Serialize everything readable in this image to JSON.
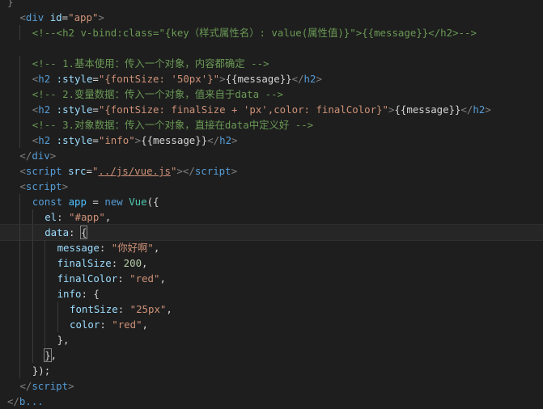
{
  "editor": {
    "lines": [
      {
        "indent": 0,
        "tokens": [
          {
            "t": "}",
            "c": "t-punct"
          }
        ]
      },
      {
        "indent": 1,
        "tokens": [
          {
            "t": "<",
            "c": "t-punct"
          },
          {
            "t": "div",
            "c": "t-tag"
          },
          {
            "t": " ",
            "c": "t-text"
          },
          {
            "t": "id",
            "c": "t-attr"
          },
          {
            "t": "=",
            "c": "t-text"
          },
          {
            "t": "\"app\"",
            "c": "t-str"
          },
          {
            "t": ">",
            "c": "t-punct"
          }
        ]
      },
      {
        "indent": 2,
        "tokens": [
          {
            "t": "<!--<h2 v-bind:class=\"{key（样式属性名）: value(属性值)}\">{{message}}</h2>-->",
            "c": "t-comment"
          }
        ]
      },
      {
        "indent": 0,
        "tokens": []
      },
      {
        "indent": 2,
        "tokens": [
          {
            "t": "<!-- 1.基本使用：传入一个对象，内容都确定 -->",
            "c": "t-comment"
          }
        ]
      },
      {
        "indent": 2,
        "tokens": [
          {
            "t": "<",
            "c": "t-punct"
          },
          {
            "t": "h2",
            "c": "t-tag"
          },
          {
            "t": " ",
            "c": "t-text"
          },
          {
            "t": ":style",
            "c": "t-attr"
          },
          {
            "t": "=",
            "c": "t-text"
          },
          {
            "t": "\"{fontSize: '50px'}\"",
            "c": "t-str"
          },
          {
            "t": ">",
            "c": "t-punct"
          },
          {
            "t": "{{message}}",
            "c": "t-text"
          },
          {
            "t": "</",
            "c": "t-punct"
          },
          {
            "t": "h2",
            "c": "t-tag"
          },
          {
            "t": ">",
            "c": "t-punct"
          }
        ]
      },
      {
        "indent": 2,
        "tokens": [
          {
            "t": "<!-- 2.变量数据：传入一个对象，值来自于data -->",
            "c": "t-comment"
          }
        ]
      },
      {
        "indent": 2,
        "tokens": [
          {
            "t": "<",
            "c": "t-punct"
          },
          {
            "t": "h2",
            "c": "t-tag"
          },
          {
            "t": " ",
            "c": "t-text"
          },
          {
            "t": ":style",
            "c": "t-attr"
          },
          {
            "t": "=",
            "c": "t-text"
          },
          {
            "t": "\"{fontSize: finalSize + 'px',color: finalColor}\"",
            "c": "t-str"
          },
          {
            "t": ">",
            "c": "t-punct"
          },
          {
            "t": "{{message}}",
            "c": "t-text"
          },
          {
            "t": "</",
            "c": "t-punct"
          },
          {
            "t": "h2",
            "c": "t-tag"
          },
          {
            "t": ">",
            "c": "t-punct"
          }
        ]
      },
      {
        "indent": 2,
        "tokens": [
          {
            "t": "<!-- 3.对象数据：传入一个对象，直接在data中定义好 -->",
            "c": "t-comment"
          }
        ]
      },
      {
        "indent": 2,
        "tokens": [
          {
            "t": "<",
            "c": "t-punct"
          },
          {
            "t": "h2",
            "c": "t-tag"
          },
          {
            "t": " ",
            "c": "t-text"
          },
          {
            "t": ":style",
            "c": "t-attr"
          },
          {
            "t": "=",
            "c": "t-text"
          },
          {
            "t": "\"info\"",
            "c": "t-str"
          },
          {
            "t": ">",
            "c": "t-punct"
          },
          {
            "t": "{{message}}",
            "c": "t-text"
          },
          {
            "t": "</",
            "c": "t-punct"
          },
          {
            "t": "h2",
            "c": "t-tag"
          },
          {
            "t": ">",
            "c": "t-punct"
          }
        ]
      },
      {
        "indent": 1,
        "tokens": [
          {
            "t": "</",
            "c": "t-punct"
          },
          {
            "t": "div",
            "c": "t-tag"
          },
          {
            "t": ">",
            "c": "t-punct"
          }
        ]
      },
      {
        "indent": 1,
        "tokens": [
          {
            "t": "<",
            "c": "t-punct"
          },
          {
            "t": "script",
            "c": "t-tag"
          },
          {
            "t": " ",
            "c": "t-text"
          },
          {
            "t": "src",
            "c": "t-attr"
          },
          {
            "t": "=",
            "c": "t-text"
          },
          {
            "t": "\"",
            "c": "t-str"
          },
          {
            "t": "../js/vue.js",
            "c": "t-link"
          },
          {
            "t": "\"",
            "c": "t-str"
          },
          {
            "t": "></",
            "c": "t-punct"
          },
          {
            "t": "script",
            "c": "t-tag"
          },
          {
            "t": ">",
            "c": "t-punct"
          }
        ]
      },
      {
        "indent": 1,
        "tokens": [
          {
            "t": "<",
            "c": "t-punct"
          },
          {
            "t": "script",
            "c": "t-tag"
          },
          {
            "t": ">",
            "c": "t-punct"
          }
        ]
      },
      {
        "indent": 2,
        "tokens": [
          {
            "t": "const",
            "c": "t-kw"
          },
          {
            "t": " ",
            "c": "t-text"
          },
          {
            "t": "app",
            "c": "t-var"
          },
          {
            "t": " = ",
            "c": "t-text"
          },
          {
            "t": "new",
            "c": "t-kw"
          },
          {
            "t": " ",
            "c": "t-text"
          },
          {
            "t": "Vue",
            "c": "t-cls"
          },
          {
            "t": "({",
            "c": "t-text"
          }
        ]
      },
      {
        "indent": 3,
        "tokens": [
          {
            "t": "el",
            "c": "t-prop"
          },
          {
            "t": ": ",
            "c": "t-text"
          },
          {
            "t": "\"#app\"",
            "c": "t-str"
          },
          {
            "t": ",",
            "c": "t-text"
          }
        ]
      },
      {
        "indent": 3,
        "current": true,
        "tokens": [
          {
            "t": "data",
            "c": "t-prop"
          },
          {
            "t": ": ",
            "c": "t-text"
          },
          {
            "t": "{",
            "c": "t-text",
            "box": true
          }
        ]
      },
      {
        "indent": 4,
        "tokens": [
          {
            "t": "message",
            "c": "t-prop"
          },
          {
            "t": ": ",
            "c": "t-text"
          },
          {
            "t": "\"你好啊\"",
            "c": "t-str"
          },
          {
            "t": ",",
            "c": "t-text"
          }
        ]
      },
      {
        "indent": 4,
        "tokens": [
          {
            "t": "finalSize",
            "c": "t-prop"
          },
          {
            "t": ": ",
            "c": "t-text"
          },
          {
            "t": "200",
            "c": "t-num"
          },
          {
            "t": ",",
            "c": "t-text"
          }
        ]
      },
      {
        "indent": 4,
        "tokens": [
          {
            "t": "finalColor",
            "c": "t-prop"
          },
          {
            "t": ": ",
            "c": "t-text"
          },
          {
            "t": "\"red\"",
            "c": "t-str"
          },
          {
            "t": ",",
            "c": "t-text"
          }
        ]
      },
      {
        "indent": 4,
        "tokens": [
          {
            "t": "info",
            "c": "t-prop"
          },
          {
            "t": ": {",
            "c": "t-text"
          }
        ]
      },
      {
        "indent": 5,
        "tokens": [
          {
            "t": "fontSize",
            "c": "t-prop"
          },
          {
            "t": ": ",
            "c": "t-text"
          },
          {
            "t": "\"25px\"",
            "c": "t-str"
          },
          {
            "t": ",",
            "c": "t-text"
          }
        ]
      },
      {
        "indent": 5,
        "tokens": [
          {
            "t": "color",
            "c": "t-prop"
          },
          {
            "t": ": ",
            "c": "t-text"
          },
          {
            "t": "\"red\"",
            "c": "t-str"
          },
          {
            "t": ",",
            "c": "t-text"
          }
        ]
      },
      {
        "indent": 4,
        "tokens": [
          {
            "t": "},",
            "c": "t-text"
          }
        ]
      },
      {
        "indent": 3,
        "tokens": [
          {
            "t": "}",
            "c": "t-text",
            "box": true
          },
          {
            "t": ",",
            "c": "t-text"
          }
        ]
      },
      {
        "indent": 2,
        "tokens": [
          {
            "t": "});",
            "c": "t-text"
          }
        ]
      },
      {
        "indent": 1,
        "tokens": [
          {
            "t": "</",
            "c": "t-punct"
          },
          {
            "t": "script",
            "c": "t-tag"
          },
          {
            "t": ">",
            "c": "t-punct"
          }
        ]
      },
      {
        "indent": 0,
        "tokens": [
          {
            "t": "</",
            "c": "t-punct"
          },
          {
            "t": "b...",
            "c": "t-tag"
          }
        ]
      }
    ]
  }
}
